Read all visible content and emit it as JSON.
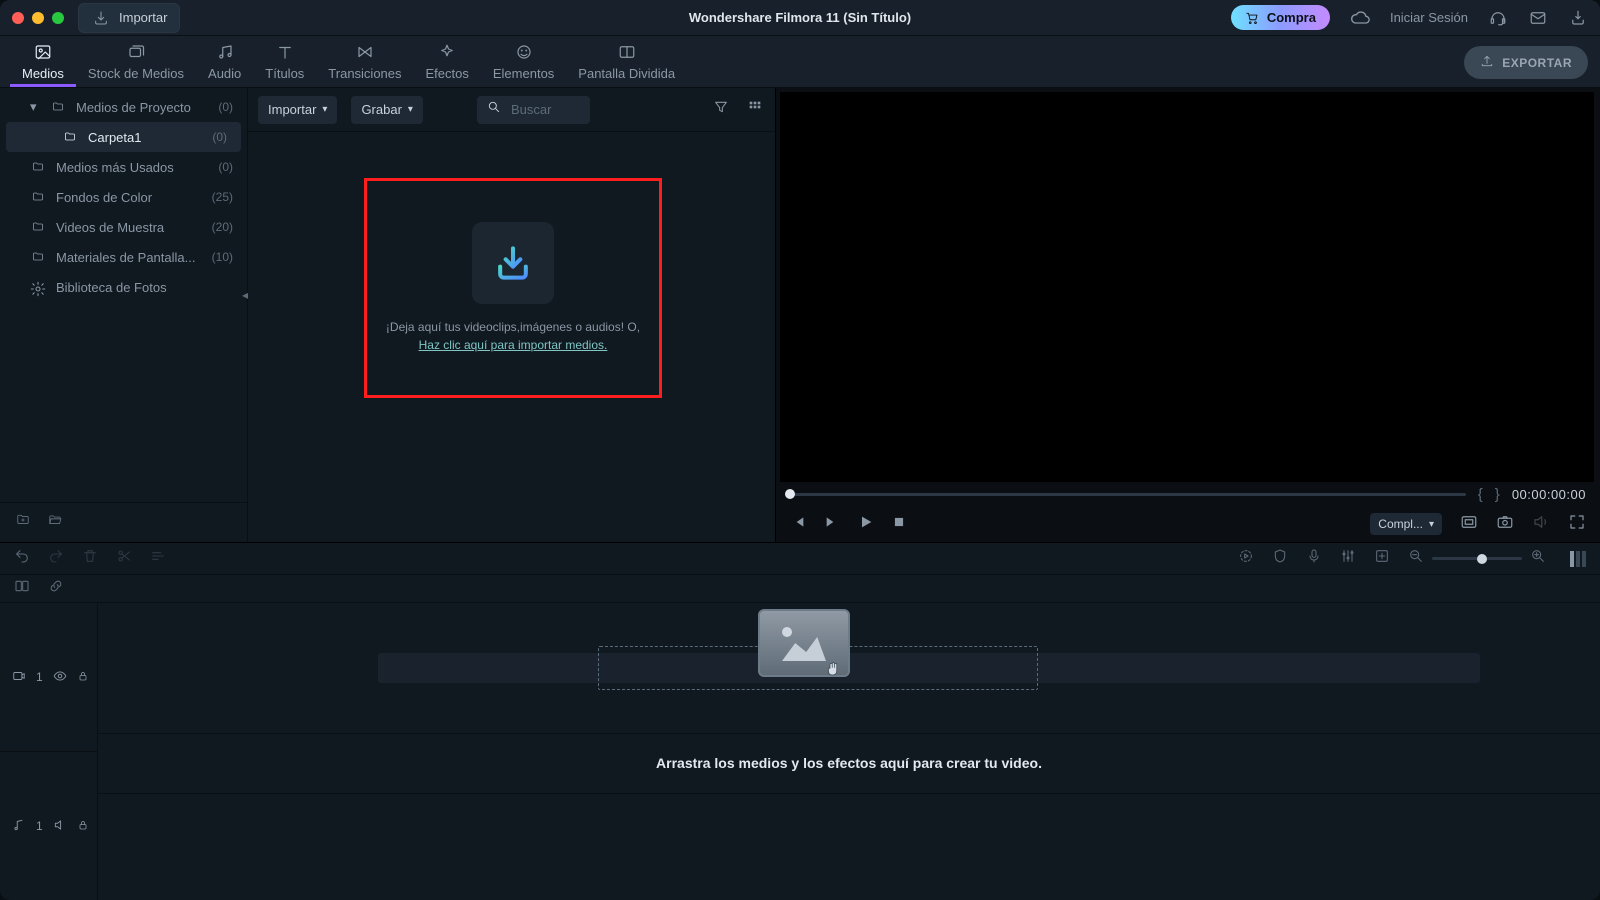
{
  "titlebar": {
    "import_label": "Importar",
    "app_title": "Wondershare Filmora 11 (Sin Título)",
    "buy_label": "Compra",
    "signin_label": "Iniciar Sesión"
  },
  "tabs": [
    {
      "label": "Medios",
      "active": true
    },
    {
      "label": "Stock de Medios",
      "active": false
    },
    {
      "label": "Audio",
      "active": false
    },
    {
      "label": "Títulos",
      "active": false
    },
    {
      "label": "Transiciones",
      "active": false
    },
    {
      "label": "Efectos",
      "active": false
    },
    {
      "label": "Elementos",
      "active": false
    },
    {
      "label": "Pantalla Dividida",
      "active": false
    }
  ],
  "export_label": "EXPORTAR",
  "media_header": {
    "import_dd": "Importar",
    "record_dd": "Grabar",
    "search_placeholder": "Buscar"
  },
  "sidebar": {
    "items": [
      {
        "label": "Medios de Proyecto",
        "count": "(0)",
        "indent": 1,
        "has_chev": true,
        "icon": "folder"
      },
      {
        "label": "Carpeta1",
        "count": "(0)",
        "indent": 2,
        "selected": true,
        "icon": "folder"
      },
      {
        "label": "Medios más Usados",
        "count": "(0)",
        "indent": 1,
        "icon": "folder"
      },
      {
        "label": "Fondos de Color",
        "count": "(25)",
        "indent": 1,
        "icon": "folder"
      },
      {
        "label": "Videos de Muestra",
        "count": "(20)",
        "indent": 1,
        "icon": "folder"
      },
      {
        "label": "Materiales de Pantalla...",
        "count": "(10)",
        "indent": 1,
        "icon": "folder"
      },
      {
        "label": "Biblioteca de Fotos",
        "count": "",
        "indent": 1,
        "icon": "gear"
      }
    ]
  },
  "dropzone": {
    "line1": "¡Deja aquí tus videoclips,imágenes o audios! O,",
    "link": "Haz clic aquí para importar medios."
  },
  "preview": {
    "timecode": "00:00:00:00",
    "quality_label": "Compl..."
  },
  "timeline": {
    "video_track_label": "1",
    "audio_track_label": "1",
    "hint": "Arrastra los medios y los efectos aquí para crear tu video."
  }
}
